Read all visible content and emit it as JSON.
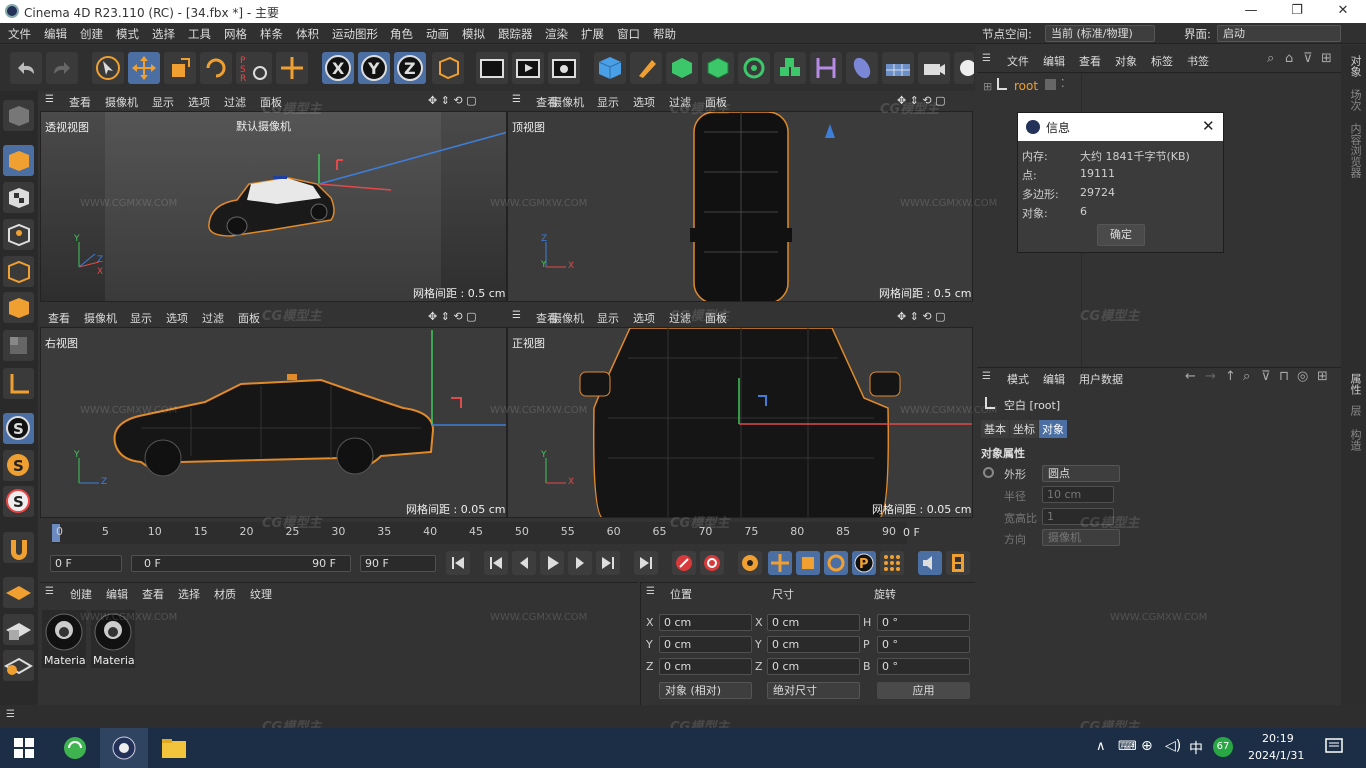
{
  "app": {
    "title": "Cinema 4D R23.110 (RC) - [34.fbx *] - 主要",
    "win_min": "—",
    "win_max": "❐",
    "win_close": "✕"
  },
  "menu": [
    "文件",
    "编辑",
    "创建",
    "模式",
    "选择",
    "工具",
    "网格",
    "样条",
    "体积",
    "运动图形",
    "角色",
    "动画",
    "模拟",
    "跟踪器",
    "渲染",
    "扩展",
    "窗口",
    "帮助"
  ],
  "node_space": {
    "label": "节点空间:",
    "value": "当前 (标准/物理)"
  },
  "interface": {
    "label": "界面:",
    "value": "启动"
  },
  "viewports": [
    {
      "menu": [
        "查看",
        "摄像机",
        "显示",
        "选项",
        "过滤",
        "面板"
      ],
      "name": "透视视图",
      "camera": "默认摄像机",
      "grid": "网格间距 : 0.5 cm"
    },
    {
      "menu": [
        "查看",
        "摄像机",
        "显示",
        "选项",
        "过滤",
        "面板"
      ],
      "name": "顶视图",
      "grid": "网格间距 : 0.5 cm"
    },
    {
      "menu": [
        "查看",
        "摄像机",
        "显示",
        "选项",
        "过滤",
        "面板"
      ],
      "name": "右视图",
      "grid": "网格间距 : 0.05 cm"
    },
    {
      "menu": [
        "查看",
        "摄像机",
        "显示",
        "选项",
        "过滤",
        "面板"
      ],
      "name": "正视图",
      "grid": "网格间距 : 0.05 cm"
    }
  ],
  "axes": {
    "x": "X",
    "y": "Y",
    "z": "Z"
  },
  "timeline": {
    "ticks": [
      "0",
      "5",
      "10",
      "15",
      "20",
      "25",
      "30",
      "35",
      "40",
      "45",
      "50",
      "55",
      "60",
      "65",
      "70",
      "75",
      "80",
      "85",
      "90"
    ],
    "end_frame": "0 F",
    "start_field": "0 F",
    "range_start": "0 F",
    "range_end": "90 F",
    "max_field": "90 F"
  },
  "materials": {
    "menu": [
      "创建",
      "编辑",
      "查看",
      "选择",
      "材质",
      "纹理"
    ],
    "items": [
      "Materia",
      "Materia"
    ]
  },
  "coords": {
    "headers": [
      "位置",
      "尺寸",
      "旋转"
    ],
    "rows": [
      {
        "a": "X",
        "pos": "0 cm",
        "b": "X",
        "size": "0 cm",
        "c": "H",
        "rot": "0 °"
      },
      {
        "a": "Y",
        "pos": "0 cm",
        "b": "Y",
        "size": "0 cm",
        "c": "P",
        "rot": "0 °"
      },
      {
        "a": "Z",
        "pos": "0 cm",
        "b": "Z",
        "size": "0 cm",
        "c": "B",
        "rot": "0 °"
      }
    ],
    "mode": "对象 (相对)",
    "size_mode": "绝对尺寸",
    "apply": "应用"
  },
  "object_manager": {
    "menu": [
      "文件",
      "编辑",
      "查看",
      "对象",
      "标签",
      "书签"
    ],
    "root": "root"
  },
  "info_dialog": {
    "title": "信息",
    "rows": [
      {
        "k": "内存:",
        "v": "大约 1841千字节(KB)"
      },
      {
        "k": "点:",
        "v": "19111"
      },
      {
        "k": "多边形:",
        "v": "29724"
      },
      {
        "k": "对象:",
        "v": "6"
      }
    ],
    "ok": "确定"
  },
  "attributes": {
    "menu": [
      "模式",
      "编辑",
      "用户数据"
    ],
    "object": "空白 [root]",
    "tabs": [
      "基本",
      "坐标",
      "对象"
    ],
    "section": "对象属性",
    "props": [
      {
        "k": "外形",
        "v": "圆点"
      },
      {
        "k": "半径",
        "v": "10 cm"
      },
      {
        "k": "宽高比",
        "v": "1"
      },
      {
        "k": "方向",
        "v": "摄像机"
      }
    ]
  },
  "side_tabs": [
    "对象",
    "场次",
    "内容浏览器",
    "属性",
    "层",
    "构造"
  ],
  "watermark": {
    "logo": "CG模型主",
    "url": "WWW.CGMXW.COM"
  },
  "taskbar": {
    "time": "20:19",
    "date": "2024/1/31",
    "ime": "中",
    "badge": "67"
  },
  "colors": {
    "accent": "#4b6ea3",
    "axis_x": "#e04a4a",
    "axis_y": "#3fc75a",
    "axis_z": "#3e7ed8",
    "orange": "#f0a030"
  }
}
